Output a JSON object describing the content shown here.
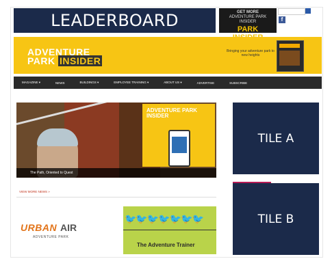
{
  "ads": {
    "leaderboard_label": "LEADERBOARD",
    "tile_a_label": "TILE A",
    "tile_b_label": "TILE B",
    "promo_line1": "GET MORE",
    "promo_line2": "ADVENTURE PARK INSIDER",
    "promo_line3": "PARK INSIDER"
  },
  "header": {
    "logo_line1": "ADVENTURE",
    "logo_line2a": "PARK",
    "logo_line2b": "INSIDER",
    "tagline": "Bringing your adventure park to new heights"
  },
  "nav": {
    "items": [
      "MAGAZINE ▾",
      "NEWS",
      "BUILDINGS ▾",
      "EMPLOYEE TRAINING ▾",
      "ABOUT US ▾",
      "ADVERTISE",
      "SUBSCRIBE"
    ]
  },
  "main": {
    "hero_caption": "The Path, Oriented to Quest",
    "magazine_title": "ADVENTURE PARK INSIDER",
    "more_link": "VIEW MORE NEWS »",
    "urban_logo_a": "URBAN",
    "urban_logo_b": "AIR",
    "urban_sub": "ADVENTURE PARK",
    "trainer_title": "The Adventure Trainer"
  },
  "colors": {
    "ad_navy": "#1b2a4a",
    "brand_yellow": "#f7c514",
    "nav_dark": "#2a2a2a",
    "link_red": "#c2361f"
  }
}
